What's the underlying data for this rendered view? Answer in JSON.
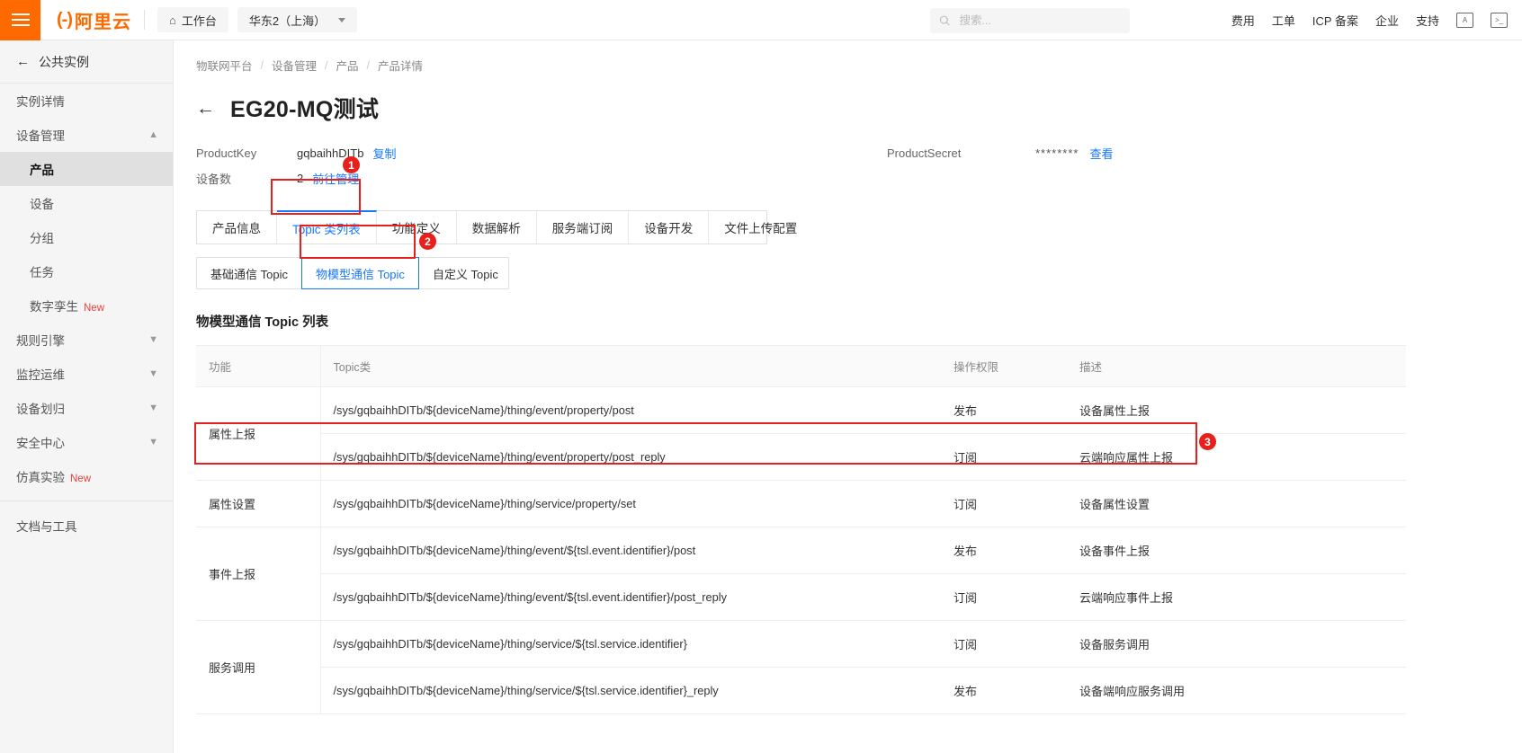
{
  "header": {
    "menu_icon": "hamburger-icon",
    "logo_mark": "(-)",
    "logo_text": "阿里云",
    "workbench": "工作台",
    "home_icon": "home-icon",
    "region": "华东2（上海）",
    "region_caret": "chevron-down-icon",
    "search_placeholder": "搜索...",
    "search_value": "",
    "search_icon": "search-icon",
    "links": [
      "费用",
      "工单",
      "ICP 备案",
      "企业",
      "支持"
    ],
    "app_icon": "app-icon",
    "terminal_icon": "terminal-icon"
  },
  "sidebar": {
    "back_label": "公共实例",
    "back_icon": "arrow-left-icon",
    "items": [
      {
        "label": "实例详情",
        "level": "top",
        "expandable": false,
        "active": false
      },
      {
        "label": "设备管理",
        "level": "top",
        "expandable": true,
        "chevron": "chevron-up-icon",
        "active": false
      },
      {
        "label": "产品",
        "level": "sub",
        "expandable": false,
        "active": true
      },
      {
        "label": "设备",
        "level": "sub",
        "expandable": false,
        "active": false
      },
      {
        "label": "分组",
        "level": "sub",
        "expandable": false,
        "active": false
      },
      {
        "label": "任务",
        "level": "sub",
        "expandable": false,
        "active": false
      },
      {
        "label": "数字孪生",
        "level": "sub",
        "expandable": false,
        "active": false,
        "tag": "New"
      },
      {
        "label": "规则引擎",
        "level": "top",
        "expandable": true,
        "chevron": "chevron-down-icon",
        "active": false
      },
      {
        "label": "监控运维",
        "level": "top",
        "expandable": true,
        "chevron": "chevron-down-icon",
        "active": false
      },
      {
        "label": "设备划归",
        "level": "top",
        "expandable": true,
        "chevron": "chevron-down-icon",
        "active": false
      },
      {
        "label": "安全中心",
        "level": "top",
        "expandable": true,
        "chevron": "chevron-down-icon",
        "active": false
      },
      {
        "label": "仿真实验",
        "level": "top",
        "expandable": false,
        "active": false,
        "tag": "New"
      },
      {
        "label": "文档与工具",
        "level": "top",
        "expandable": false,
        "active": false,
        "divider_before": true
      }
    ],
    "collapse_icon": "chevron-left-icon"
  },
  "main": {
    "breadcrumb": [
      "物联网平台",
      "设备管理",
      "产品",
      "产品详情"
    ],
    "breadcrumb_sep": "/",
    "back_icon": "arrow-left-icon",
    "page_title": "EG20-MQ测试",
    "meta": {
      "product_key_label": "ProductKey",
      "product_key_value": "gqbaihhDITb",
      "copy_label": "复制",
      "device_count_label": "设备数",
      "device_count_value": "2",
      "goto_manage_label": "前往管理",
      "product_secret_label": "ProductSecret",
      "product_secret_value": "********",
      "view_label": "查看"
    },
    "tabs": [
      {
        "label": "产品信息",
        "active": false
      },
      {
        "label": "Topic 类列表",
        "active": true
      },
      {
        "label": "功能定义",
        "active": false
      },
      {
        "label": "数据解析",
        "active": false
      },
      {
        "label": "服务端订阅",
        "active": false
      },
      {
        "label": "设备开发",
        "active": false
      },
      {
        "label": "文件上传配置",
        "active": false
      }
    ],
    "subtabs": [
      {
        "label": "基础通信 Topic",
        "active": false
      },
      {
        "label": "物模型通信 Topic",
        "active": true
      },
      {
        "label": "自定义 Topic",
        "active": false
      }
    ],
    "section_title": "物模型通信 Topic 列表",
    "table": {
      "columns": [
        "功能",
        "Topic类",
        "操作权限",
        "描述"
      ],
      "groups": [
        {
          "function": "属性上报",
          "rows": [
            {
              "topic": "/sys/gqbaihhDITb/${deviceName}/thing/event/property/post",
              "permission": "发布",
              "description": "设备属性上报"
            },
            {
              "topic": "/sys/gqbaihhDITb/${deviceName}/thing/event/property/post_reply",
              "permission": "订阅",
              "description": "云端响应属性上报"
            }
          ]
        },
        {
          "function": "属性设置",
          "highlighted": true,
          "rows": [
            {
              "topic": "/sys/gqbaihhDITb/${deviceName}/thing/service/property/set",
              "permission": "订阅",
              "description": "设备属性设置"
            }
          ]
        },
        {
          "function": "事件上报",
          "rows": [
            {
              "topic": "/sys/gqbaihhDITb/${deviceName}/thing/event/${tsl.event.identifier}/post",
              "permission": "发布",
              "description": "设备事件上报"
            },
            {
              "topic": "/sys/gqbaihhDITb/${deviceName}/thing/event/${tsl.event.identifier}/post_reply",
              "permission": "订阅",
              "description": "云端响应事件上报"
            }
          ]
        },
        {
          "function": "服务调用",
          "rows": [
            {
              "topic": "/sys/gqbaihhDITb/${deviceName}/thing/service/${tsl.service.identifier}",
              "permission": "订阅",
              "description": "设备服务调用"
            },
            {
              "topic": "/sys/gqbaihhDITb/${deviceName}/thing/service/${tsl.service.identifier}_reply",
              "permission": "发布",
              "description": "设备端响应服务调用"
            }
          ]
        }
      ]
    }
  },
  "annotations": {
    "color": "#e8201c",
    "markers": [
      {
        "id": "1",
        "label": "1"
      },
      {
        "id": "2",
        "label": "2"
      },
      {
        "id": "3",
        "label": "3"
      }
    ]
  },
  "colors": {
    "brand_orange": "#ff6a00",
    "link_blue": "#1677ff",
    "annotation_red": "#e8201c",
    "new_tag_red": "#e8403a"
  }
}
